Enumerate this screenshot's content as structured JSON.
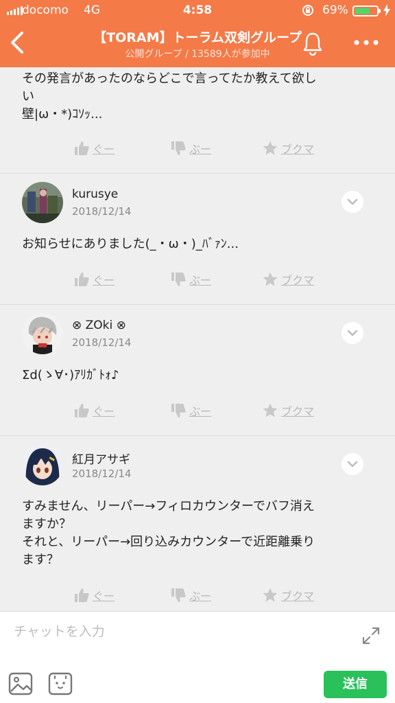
{
  "status_bar": {
    "carrier": "docomo",
    "network": "4G",
    "time": "4:58",
    "battery_percent": "69%",
    "battery_level": 0.69,
    "battery_color": "#4cd964"
  },
  "header": {
    "title": "【TORAM】トーラム双剣グループ",
    "subtitle": "公開グループ / 13589人が参加中",
    "back_icon": "chevron-left-icon",
    "bell_icon": "bell-icon",
    "more_icon": "more-dots-icon",
    "background_color": "#f47a48"
  },
  "posts": [
    {
      "author": "",
      "date": "",
      "body": "その発言があったのならどこで言ってたか教えて欲し\nい\n壁|ω・*)ｺｿｯ..."
    },
    {
      "author": "kurusye",
      "date": "2018/12/14",
      "body": "お知らせにありました(_・ω・)_ﾊﾞｧﾝ..."
    },
    {
      "author": "⊗ ZOki ⊗",
      "date": "2018/12/14",
      "body": "Σd(ゝ∀･)ｱﾘｶﾞﾄｫ♪"
    },
    {
      "author": "紅月アサギ",
      "date": "2018/12/14",
      "body": "すみません、リーパー→フィロカウンターでバフ消え\nますか？\nそれと、リーパー→回り込みカウンターで近距離乗り\nます？"
    }
  ],
  "actions": {
    "like": "ぐー",
    "dislike": "ぶー",
    "bookmark": "ブクマ"
  },
  "input_bar": {
    "placeholder": "チャットを入力",
    "send_label": "送信",
    "send_color": "#2ac15a"
  }
}
